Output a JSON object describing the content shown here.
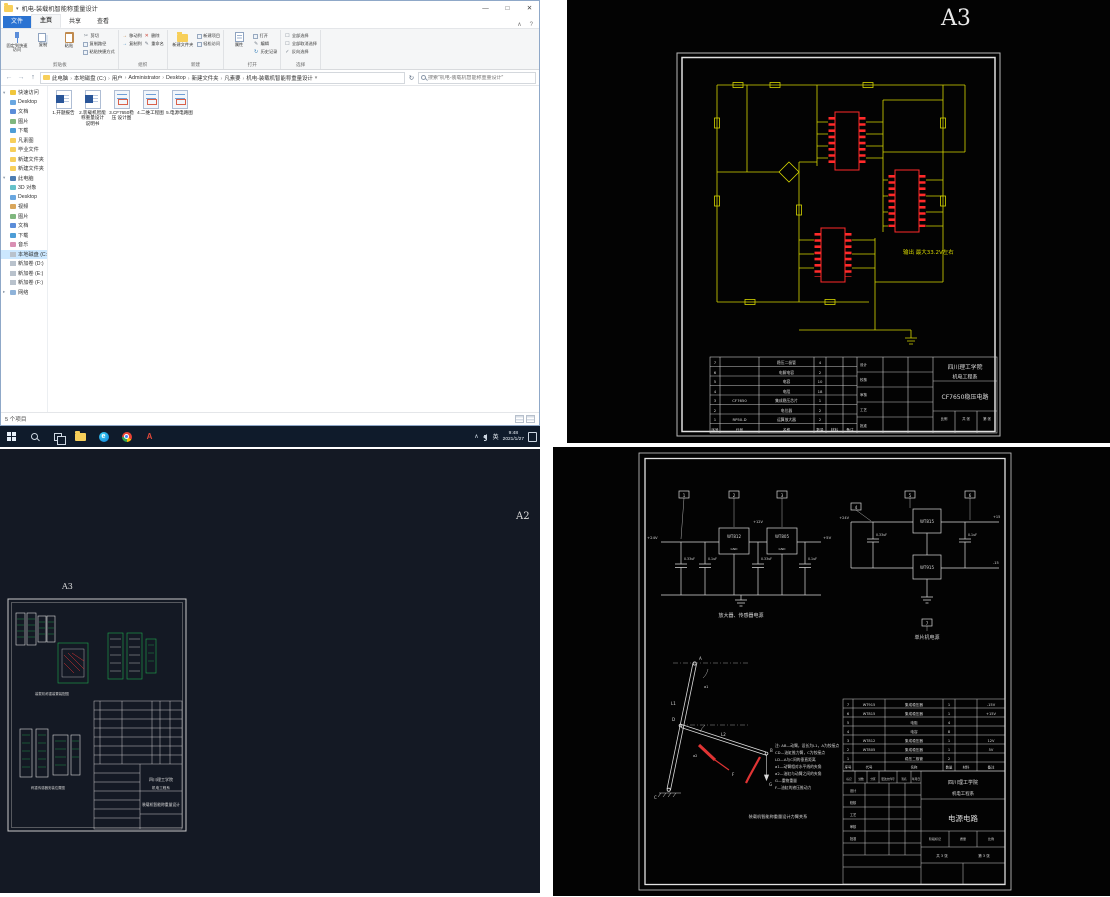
{
  "colors": {
    "wire_yellow": "#d6d600",
    "ic_red": "#ff2a2a",
    "cad_green": "#1fa84f",
    "cad_line": "#d9d9d9",
    "taskbar_bg": "#0f1b2b",
    "selection": "#cce8ff",
    "file_tab_blue": "#2b73d2",
    "mech_red": "#e03434"
  },
  "glyphs": {
    "back": "←",
    "forward": "→",
    "up": "↑",
    "refresh": "↻",
    "dropdown": "▾",
    "expand": "▸",
    "minimize": "—",
    "maximize": "□",
    "close": "✕",
    "help": "?",
    "collapse_ribbon": "∧",
    "cut": "✂",
    "pencil": "✎",
    "check": "✓",
    "cross": "✕",
    "box": "☐",
    "arrow": "→",
    "tray_up": "∧",
    "edge": "e",
    "autocad": "A"
  },
  "explorer": {
    "window_title": "机电-装载机智能称重量设计",
    "tabs": {
      "file": "文件",
      "home": "主页",
      "share": "共享",
      "view": "查看"
    },
    "ribbon": {
      "clipboard": {
        "group": "剪贴板",
        "pin": "固定到快速访问",
        "copy": "复制",
        "paste": "粘贴",
        "cut": "剪切",
        "copy_path": "复制路径",
        "paste_shortcut": "粘贴快捷方式"
      },
      "organize": {
        "group": "组织",
        "move_to": "移动到",
        "copy_to": "复制到",
        "delete": "删除",
        "rename": "重命名"
      },
      "new": {
        "group": "新建",
        "new_folder": "新建文件夹",
        "new_item": "新建项目",
        "easy_access": "轻松访问"
      },
      "open": {
        "group": "打开",
        "properties": "属性",
        "open": "打开",
        "edit": "编辑",
        "history": "历史记录"
      },
      "select": {
        "group": "选择",
        "select_all": "全部选择",
        "select_none": "全部取消选择",
        "invert": "反向选择"
      }
    },
    "address": {
      "segments": [
        "此电脑",
        "本地磁盘 (C:)",
        "用户",
        "Administrator",
        "Desktop",
        "新建文件夹",
        "凡素要",
        "机电-装载机智能称重量设计"
      ],
      "search_placeholder": "搜索\"机电-装载机智能称重量设计\""
    },
    "sidebar": {
      "quick_access_label": "快速访问",
      "quick_access": [
        "Desktop",
        "文档",
        "图片",
        "下载",
        "凡素图",
        "毕业文件",
        "新建文件夹",
        "新建文件夹"
      ],
      "this_pc_label": "此电脑",
      "this_pc": [
        "3D 对象",
        "Desktop",
        "视频",
        "图片",
        "文档",
        "下载",
        "音乐",
        "本地磁盘 (C:)",
        "新加卷 (D:)",
        "新加卷 (E:)",
        "新加卷 (F:)"
      ],
      "network_label": "网络"
    },
    "files": [
      {
        "name": "1.开题报告"
      },
      {
        "name": "2.装载机智能称重量设计 说明书"
      },
      {
        "name": "3.CF7650稳压 设计图"
      },
      {
        "name": "4.二维工程图"
      },
      {
        "name": "5.电源电路图"
      }
    ],
    "status": "5 个项目"
  },
  "taskbar": {
    "ime": "英",
    "time": "9:48",
    "date": "2021/1/27"
  },
  "cad_cf7650": {
    "sheet": "A3",
    "output_note": "输出 最大33.2V左右",
    "parts_header": [
      "序号",
      "代号",
      "名称",
      "数量",
      "材料",
      "备注"
    ],
    "parts": [
      {
        "seq": "7",
        "code": "",
        "name": "稳压二极管",
        "qty": "4"
      },
      {
        "seq": "6",
        "code": "",
        "name": "电解电容",
        "qty": "2"
      },
      {
        "seq": "5",
        "code": "",
        "name": "电容",
        "qty": "10"
      },
      {
        "seq": "4",
        "code": "",
        "name": "电阻",
        "qty": "18"
      },
      {
        "seq": "3",
        "code": "CF7650",
        "name": "集成稳压芯片",
        "qty": "1"
      },
      {
        "seq": "2",
        "code": "",
        "name": "电位器",
        "qty": "2"
      },
      {
        "seq": "1",
        "code": "RP50-D",
        "name": "运算放大器",
        "qty": "2"
      }
    ],
    "title_block": {
      "school": "四川理工学院",
      "department": "机电工程系",
      "title": "CF7650稳压电路",
      "sign_rows": [
        "设计",
        "校核",
        "审核",
        "工艺",
        "批准"
      ],
      "scale_label": "比例",
      "sheets_total": "共 张",
      "sheet_no": "第 张"
    }
  },
  "cad_mech": {
    "sheet_outer": "A2",
    "sheet_inner": "A3",
    "caption_top": "装载机称重装置装配图",
    "caption_bottom": "称重传感器安装位置图",
    "title_block": {
      "school": "四川理工学院",
      "department": "机电工程系",
      "title": "装载机智能称重量设计"
    }
  },
  "cad_power": {
    "callouts": [
      "1",
      "2",
      "3",
      "4",
      "5",
      "6",
      "7"
    ],
    "left_circuit": {
      "input": "+24V",
      "chip1": "WT812",
      "mid": "+12V",
      "chip2": "WT805",
      "output": "+5V",
      "gnd": "GND",
      "cap1": "0.33uF",
      "cap2": "0.1uF",
      "cap3": "0.33uF",
      "cap4": "0.1uF",
      "caption": "放大器、传感器电源"
    },
    "right_circuit": {
      "input": "+24V",
      "chip1": "WT815",
      "out1": "+15",
      "chip2": "WT915",
      "out2": "-15",
      "cap1": "0.33uF",
      "cap2": "0.1uF",
      "caption": "单片机电源"
    },
    "mech": {
      "labels": {
        "A": "A",
        "B": "B",
        "C": "C",
        "D": "D",
        "F": "F",
        "G": "G",
        "L1": "L1",
        "L2": "L2",
        "a1": "a1",
        "a2": "a2"
      },
      "notes": [
        "注: AB—动臂，设长为L1，A为铰接点",
        "CD—油缸推力臂，C为铰接点",
        "LD—A与C间的垂直距离",
        "a1—动臂相对水平线的夹角",
        "a2—油缸与动臂之间的夹角",
        "G—重物重量",
        "F—油缸的液压推动力"
      ],
      "caption": "装载机智能称重量设计力臂关系"
    },
    "parts_header": [
      "序号",
      "代号",
      "名称",
      "数量",
      "材料",
      "备注"
    ],
    "parts": [
      {
        "seq": "7",
        "code": "WT915",
        "name": "集成稳压器",
        "qty": "1",
        "remark": "-15V"
      },
      {
        "seq": "6",
        "code": "WT815",
        "name": "集成稳压器",
        "qty": "1",
        "remark": "+15V"
      },
      {
        "seq": "5",
        "code": "",
        "name": "电阻",
        "qty": "4",
        "remark": ""
      },
      {
        "seq": "4",
        "code": "",
        "name": "电容",
        "qty": "8",
        "remark": ""
      },
      {
        "seq": "3",
        "code": "WT812",
        "name": "集成稳压器",
        "qty": "1",
        "remark": "12V"
      },
      {
        "seq": "2",
        "code": "WT805",
        "name": "集成稳压器",
        "qty": "1",
        "remark": "5V"
      },
      {
        "seq": "1",
        "code": "",
        "name": "稳压二极管",
        "qty": "2",
        "remark": ""
      }
    ],
    "title_block": {
      "school": "四川理工学院",
      "department": "机电工程系",
      "title": "电源电路",
      "header_row": [
        "标记",
        "处数",
        "分区",
        "更改文件号",
        "签名",
        "年月日"
      ],
      "sign_rows": [
        "设计",
        "校核",
        "工艺",
        "审核",
        "批准"
      ],
      "stage": "阶段标记",
      "mass": "质量",
      "scale": "比例",
      "sheets_total": "共 3 张",
      "sheet_no": "第 3 张"
    }
  }
}
